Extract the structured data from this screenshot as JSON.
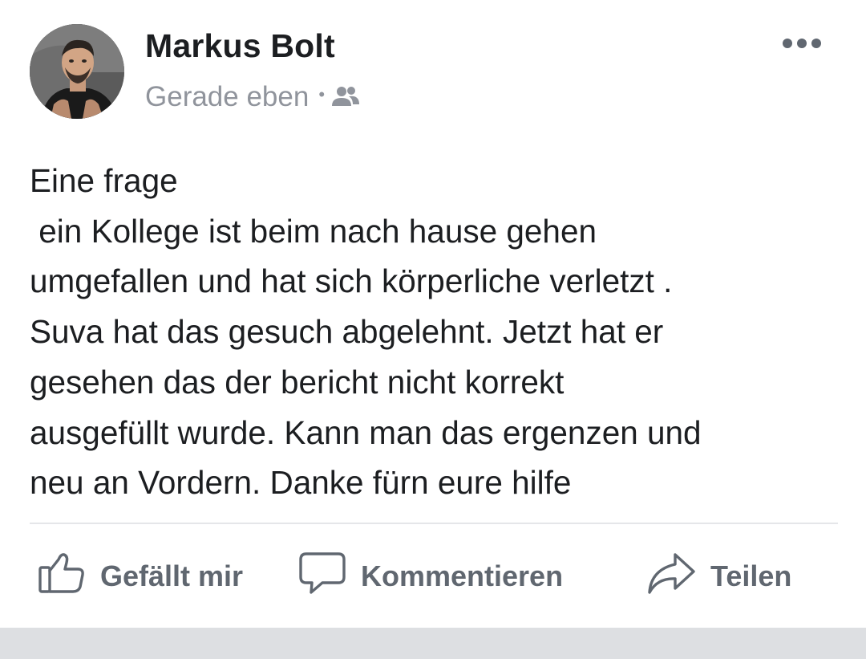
{
  "post": {
    "author": {
      "name": "Markus Bolt",
      "avatar_icon": "profile-photo"
    },
    "timestamp": "Gerade eben",
    "separator": "•",
    "audience_icon": "friends-icon",
    "more_icon": "more-dots-icon",
    "text": "Eine frage\n ein Kollege ist beim nach hause gehen\numgefallen und hat sich körperliche verletzt .\nSuva hat das gesuch abgelehnt. Jetzt hat er\ngesehen das der bericht nicht korrekt\nausgefüllt wurde. Kann man das ergenzen und\nneu an Vordern. Danke fürn eure hilfe"
  },
  "actions": {
    "like_label": "Gefällt mir",
    "comment_label": "Kommentieren",
    "share_label": "Teilen"
  },
  "colors": {
    "text": "#1c1e21",
    "secondary": "#90949c",
    "action": "#606770",
    "divider": "#e5e6e9",
    "footer": "#dddfe2"
  }
}
